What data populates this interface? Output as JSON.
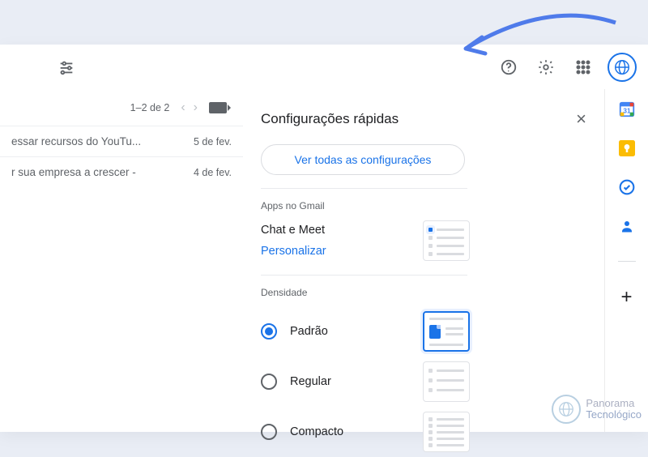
{
  "toolbar": {
    "count_label": "1–2 de 2"
  },
  "mails": [
    {
      "subject": "essar recursos do YouTu...",
      "date": "5 de fev."
    },
    {
      "subject": "r sua empresa a crescer - ",
      "date": "4 de fev."
    }
  ],
  "quick_settings": {
    "title": "Configurações rápidas",
    "see_all_label": "Ver todas as configurações",
    "apps_section": {
      "title": "Apps no Gmail",
      "item": "Chat e Meet",
      "customize": "Personalizar"
    },
    "density": {
      "title": "Densidade",
      "options": [
        {
          "label": "Padrão",
          "checked": true
        },
        {
          "label": "Regular",
          "checked": false
        },
        {
          "label": "Compacto",
          "checked": false
        }
      ]
    }
  },
  "watermark": {
    "line1": "Panorama",
    "line2": "Tecnológico"
  }
}
